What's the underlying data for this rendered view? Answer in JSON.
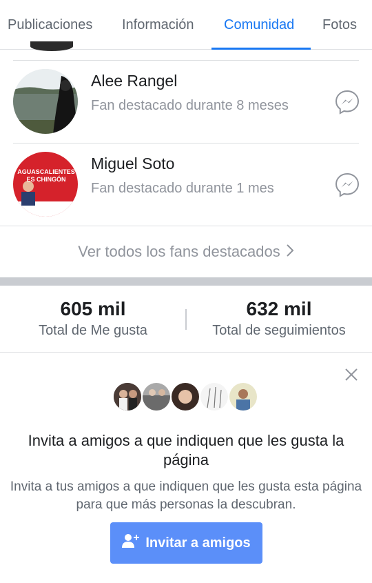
{
  "tabs": [
    {
      "label": "Publicaciones",
      "active": false
    },
    {
      "label": "Información",
      "active": false
    },
    {
      "label": "Comunidad",
      "active": true
    },
    {
      "label": "Fotos",
      "active": false
    }
  ],
  "fans": [
    {
      "name": "Alee Rangel",
      "subtitle": "Fan destacado durante 8 meses",
      "icon": "messenger-icon"
    },
    {
      "name": "Miguel Soto",
      "subtitle": "Fan destacado durante 1 mes",
      "icon": "messenger-icon",
      "avatar_text": "AGUASCALIENTES ES CHINGÓN"
    }
  ],
  "see_all": {
    "label": "Ver todos los fans destacados",
    "icon": "chevron-right-icon"
  },
  "stats": [
    {
      "value": "605 mil",
      "label": "Total de Me gusta"
    },
    {
      "value": "632 mil",
      "label": "Total de seguimientos"
    }
  ],
  "invite": {
    "title": "Invita a amigos a que indiquen que les gusta la página",
    "text": "Invita a tus amigos a que indiquen que les gusta esta página para que más personas la descubran.",
    "button_label": "Invitar a amigos",
    "button_icon": "add-person-icon",
    "close_icon": "close-icon"
  },
  "colors": {
    "accent": "#1877f2",
    "button": "#5b8ff9",
    "muted": "#90949c",
    "divider": "#dddfe2",
    "band": "#c9ccd1"
  }
}
